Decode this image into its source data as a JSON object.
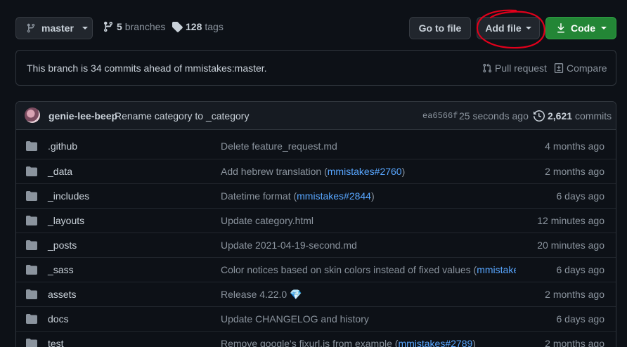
{
  "toolbar": {
    "branch_label": "master",
    "branches_count": "5",
    "branches_label": "branches",
    "tags_count": "128",
    "tags_label": "tags",
    "go_to_file_label": "Go to file",
    "add_file_label": "Add file",
    "code_label": "Code"
  },
  "ahead_notice": {
    "text": "This branch is 34 commits ahead of mmistakes:master.",
    "pull_request_label": "Pull request",
    "compare_label": "Compare"
  },
  "latest_commit": {
    "author": "genie-lee-beep",
    "message": "Rename category to _category",
    "sha": "ea6566f",
    "time": "25 seconds ago",
    "count": "2,621",
    "count_label": "commits"
  },
  "files": [
    {
      "name": ".github",
      "message": "Delete feature_request.md",
      "ref": "",
      "suffix": "",
      "age": "4 months ago"
    },
    {
      "name": "_data",
      "message": "Add hebrew translation (",
      "ref": "mmistakes#2760",
      "suffix": ")",
      "age": "2 months ago"
    },
    {
      "name": "_includes",
      "message": "Datetime format (",
      "ref": "mmistakes#2844",
      "suffix": ")",
      "age": "6 days ago"
    },
    {
      "name": "_layouts",
      "message": "Update category.html",
      "ref": "",
      "suffix": "",
      "age": "12 minutes ago"
    },
    {
      "name": "_posts",
      "message": "Update 2021-04-19-second.md",
      "ref": "",
      "suffix": "",
      "age": "20 minutes ago"
    },
    {
      "name": "_sass",
      "message": "Color notices based on skin colors instead of fixed values (",
      "ref": "mmistakes…",
      "suffix": "",
      "age": "6 days ago"
    },
    {
      "name": "assets",
      "message": "Release 4.22.0 ",
      "ref": "",
      "suffix": "💎",
      "age": "2 months ago"
    },
    {
      "name": "docs",
      "message": "Update CHANGELOG and history",
      "ref": "",
      "suffix": "",
      "age": "6 days ago"
    },
    {
      "name": "test",
      "message": "Remove google's fixurl.js from example (",
      "ref": "mmistakes#2789",
      "suffix": ")",
      "age": "2 months ago"
    }
  ],
  "colors": {
    "background": "#0d1117",
    "code_button": "#238636",
    "link": "#58a6ff",
    "annotation": "#e0001b"
  },
  "icons": {
    "branch": "git-branch-icon",
    "tag": "tag-icon",
    "download": "download-icon",
    "pull_request": "pull-request-icon",
    "compare": "compare-icon",
    "history": "history-icon",
    "folder": "folder-icon"
  }
}
